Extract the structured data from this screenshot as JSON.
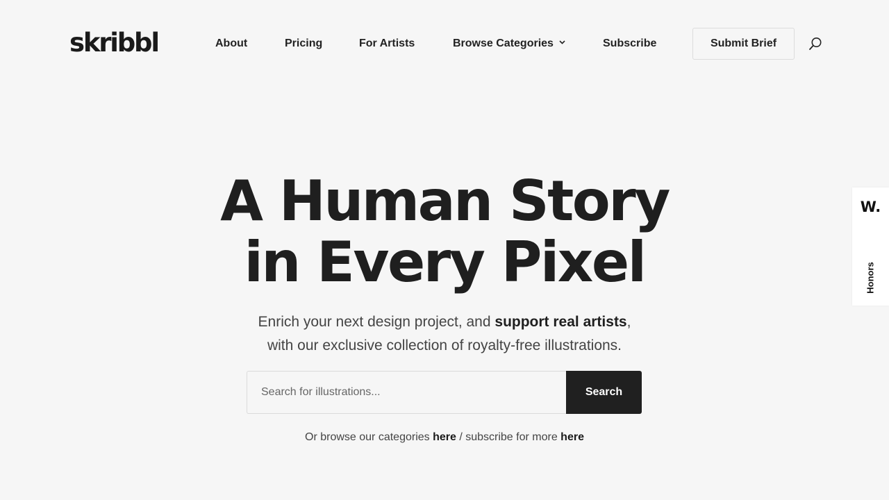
{
  "header": {
    "logo": "skribbl",
    "nav": [
      {
        "label": "About"
      },
      {
        "label": "Pricing"
      },
      {
        "label": "For Artists"
      },
      {
        "label": "Browse Categories"
      },
      {
        "label": "Subscribe"
      }
    ],
    "submit_brief": "Submit Brief"
  },
  "hero": {
    "title_line1": "A Human Story",
    "title_line2": "in Every Pixel",
    "subtitle_part1": "Enrich your next design project, and ",
    "subtitle_bold": "support real artists",
    "subtitle_part2": ",",
    "subtitle_line2": "with our exclusive collection of royalty-free illustrations."
  },
  "search": {
    "placeholder": "Search for illustrations...",
    "button_label": "Search"
  },
  "browse": {
    "prefix": "Or browse our categories ",
    "link1": "here",
    "middle": " / subscribe for more ",
    "link2": "here"
  },
  "honors": {
    "logo": "W.",
    "label": "Honors"
  },
  "icons": {
    "search": "search-icon",
    "dropdown": "chevron-down-icon"
  },
  "colors": {
    "background": "#f6f6f6",
    "text": "#1f1f1f",
    "button_dark": "#202020"
  }
}
